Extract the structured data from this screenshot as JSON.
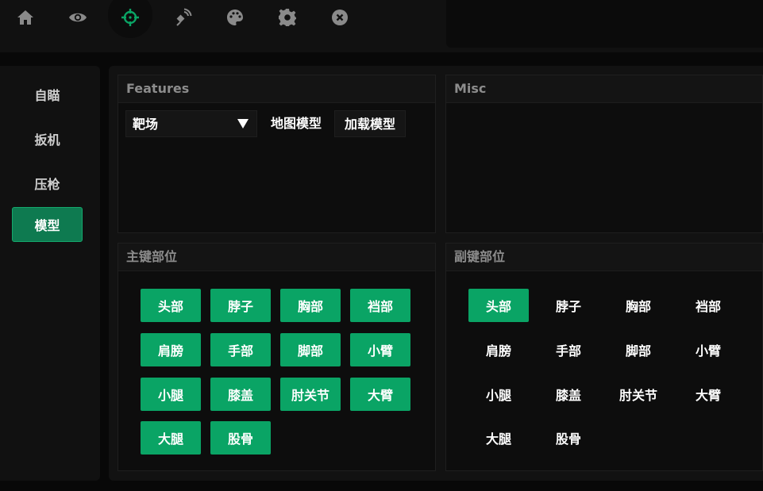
{
  "toolbar": {
    "icons": [
      "home-icon",
      "eye-icon",
      "crosshair-icon",
      "satellite-icon",
      "palette-icon",
      "gear-icon",
      "close-icon"
    ],
    "active_index": 2,
    "accent": "#0aa465"
  },
  "sidebar": {
    "items": [
      {
        "label": "自瞄",
        "active": false
      },
      {
        "label": "扳机",
        "active": false
      },
      {
        "label": "压枪",
        "active": false
      },
      {
        "label": "模型",
        "active": true
      }
    ]
  },
  "features": {
    "title": "Features",
    "select_value": "靶场",
    "map_model_label": "地图模型",
    "load_model_label": "加载模型"
  },
  "misc": {
    "title": "Misc"
  },
  "primary": {
    "title": "主键部位",
    "bones": [
      {
        "label": "头部",
        "on": true
      },
      {
        "label": "脖子",
        "on": true
      },
      {
        "label": "胸部",
        "on": true
      },
      {
        "label": "裆部",
        "on": true
      },
      {
        "label": "肩膀",
        "on": true
      },
      {
        "label": "手部",
        "on": true
      },
      {
        "label": "脚部",
        "on": true
      },
      {
        "label": "小臂",
        "on": true
      },
      {
        "label": "小腿",
        "on": true
      },
      {
        "label": "膝盖",
        "on": true
      },
      {
        "label": "肘关节",
        "on": true
      },
      {
        "label": "大臂",
        "on": true
      },
      {
        "label": "大腿",
        "on": true
      },
      {
        "label": "股骨",
        "on": true
      }
    ]
  },
  "secondary": {
    "title": "副键部位",
    "bones": [
      {
        "label": "头部",
        "on": true
      },
      {
        "label": "脖子",
        "on": false
      },
      {
        "label": "胸部",
        "on": false
      },
      {
        "label": "裆部",
        "on": false
      },
      {
        "label": "肩膀",
        "on": false
      },
      {
        "label": "手部",
        "on": false
      },
      {
        "label": "脚部",
        "on": false
      },
      {
        "label": "小臂",
        "on": false
      },
      {
        "label": "小腿",
        "on": false
      },
      {
        "label": "膝盖",
        "on": false
      },
      {
        "label": "肘关节",
        "on": false
      },
      {
        "label": "大臂",
        "on": false
      },
      {
        "label": "大腿",
        "on": false
      },
      {
        "label": "股骨",
        "on": false
      }
    ]
  }
}
